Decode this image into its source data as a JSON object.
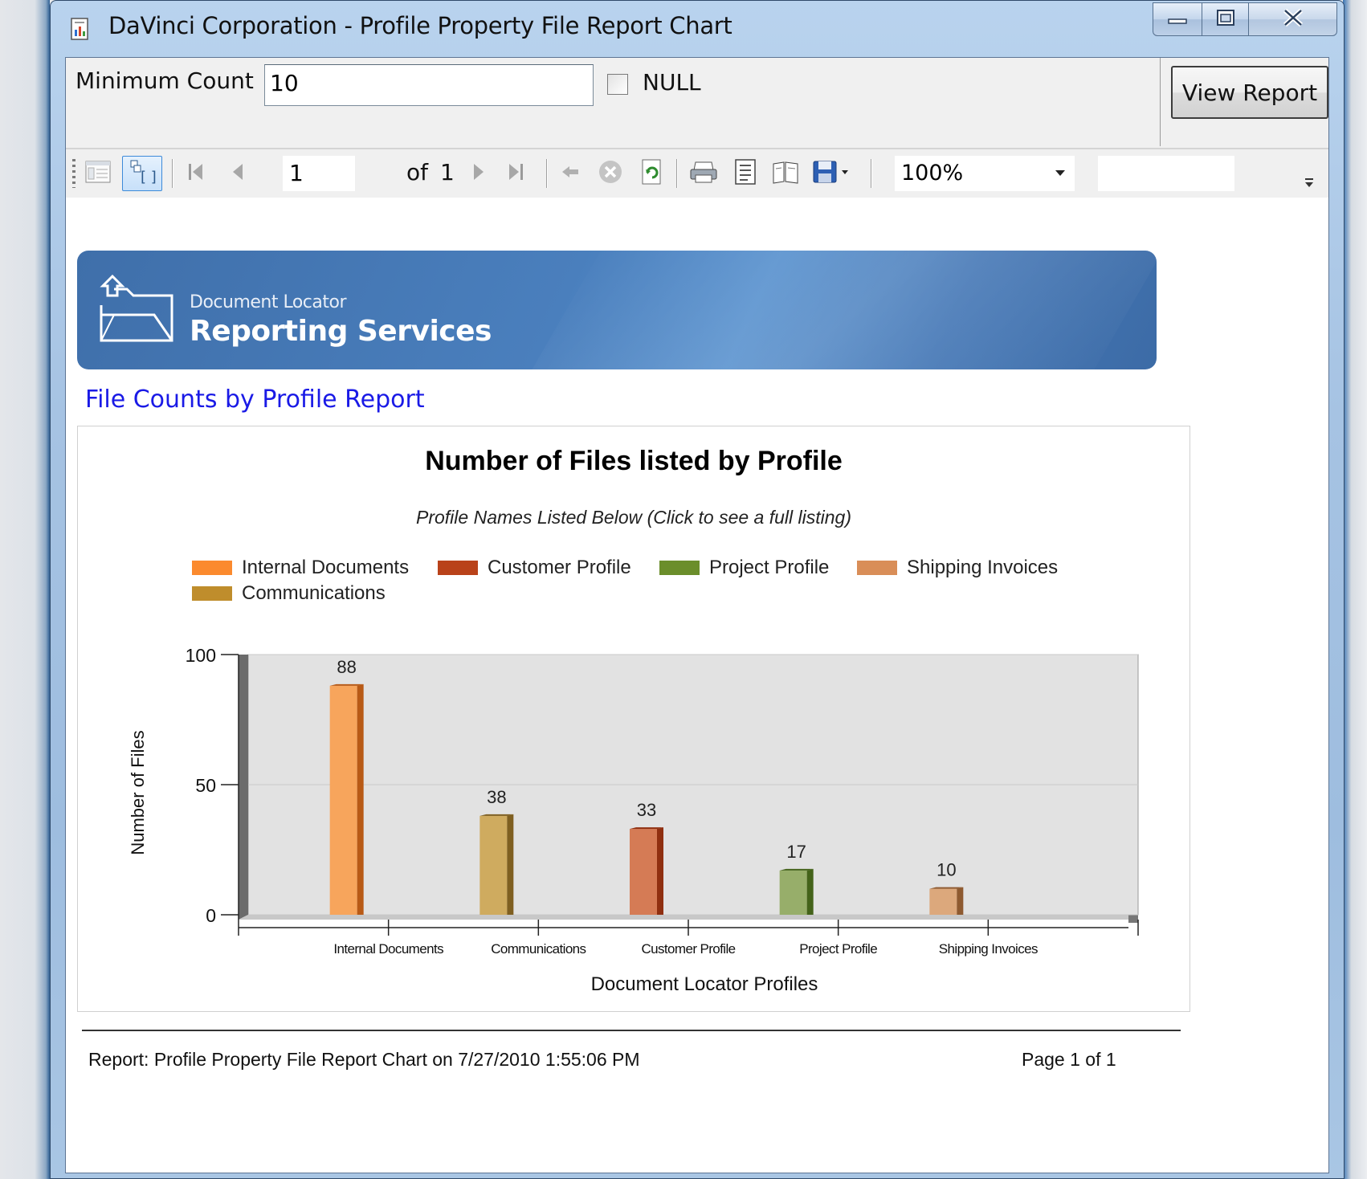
{
  "window": {
    "title": "DaVinci Corporation - Profile Property File Report Chart",
    "minimize_icon": "minimize-icon",
    "maximize_icon": "maximize-icon",
    "close_icon": "close-icon"
  },
  "params": {
    "min_count_label": "Minimum Count",
    "min_count_value": "10",
    "null_label": "NULL",
    "null_checked": false,
    "view_report_label": "View Report"
  },
  "toolbar": {
    "page_current": "1",
    "of_label": "of",
    "page_total": "1",
    "zoom": "100%",
    "icons": [
      "doc-map-icon",
      "parameters-icon",
      "first-page-icon",
      "prev-page-icon",
      "next-page-icon",
      "last-page-icon",
      "back-icon",
      "stop-icon",
      "refresh-icon",
      "print-icon",
      "print-layout-icon",
      "page-setup-icon",
      "export-icon",
      "zoom-dropdown-icon"
    ]
  },
  "banner": {
    "subtitle": "Document Locator",
    "title": "Reporting Services"
  },
  "report": {
    "heading": "File Counts by Profile Report",
    "footer_left": "Report: Profile Property File Report Chart on 7/27/2010 1:55:06 PM",
    "footer_right": "Page 1 of 1"
  },
  "chart_data": {
    "type": "bar",
    "title": "Number of Files listed by Profile",
    "subtitle": "Profile Names Listed Below (Click to see a full listing)",
    "xlabel": "Document Locator Profiles",
    "ylabel": "Number of Files",
    "ylim": [
      0,
      100
    ],
    "yticks": [
      0,
      50,
      100
    ],
    "categories": [
      "Internal Documents",
      "Communications",
      "Customer Profile",
      "Project Profile",
      "Shipping Invoices"
    ],
    "values": [
      88,
      38,
      33,
      17,
      10
    ],
    "colors": [
      "#f7a55c",
      "#cfab5f",
      "#d57b55",
      "#97ae6a",
      "#dca87c"
    ],
    "side_colors": [
      "#b85a16",
      "#7f5f20",
      "#8f2f10",
      "#44631a",
      "#8e5a30"
    ],
    "legend": [
      {
        "label": "Internal Documents",
        "color": "#fb8a2e"
      },
      {
        "label": "Customer Profile",
        "color": "#b9421a"
      },
      {
        "label": "Project Profile",
        "color": "#6b8e2b"
      },
      {
        "label": "Shipping Invoices",
        "color": "#d98e58"
      },
      {
        "label": "Communications",
        "color": "#bf8d2c"
      }
    ],
    "legend_position": "top",
    "grid": true
  }
}
